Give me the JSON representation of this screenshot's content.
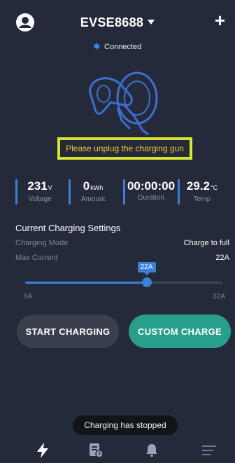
{
  "header": {
    "device_name": "EVSE8688",
    "avatar_icon": "user-avatar-icon",
    "dropdown_icon": "caret-down-icon",
    "add_icon": "plus-icon",
    "add_label": "+"
  },
  "connection": {
    "icon": "bluetooth-icon",
    "glyph": "✱",
    "status": "Connected"
  },
  "notice": {
    "text": "Please unplug the charging gun",
    "highlight_color": "#d8e632",
    "text_color": "#f1cc2e"
  },
  "stats": [
    {
      "value": "231",
      "unit": "V",
      "label": "Voltage"
    },
    {
      "value": "0",
      "unit": "kWh",
      "label": "Amount"
    },
    {
      "value": "00:00:00",
      "unit": "",
      "label": "Duration"
    },
    {
      "value": "29.2",
      "unit": "°C",
      "label": "Temp"
    }
  ],
  "settings": {
    "title": "Current Charging Settings",
    "mode_label": "Charging Mode",
    "mode_value": "Charge to full",
    "current_label": "Max Current",
    "current_value": "22A",
    "slider": {
      "min": 6,
      "max": 32,
      "value": 22,
      "min_label": "6A",
      "max_label": "32A",
      "tooltip": "22A"
    }
  },
  "buttons": {
    "start": "START CHARGING",
    "custom": "CUSTOM CHARGE"
  },
  "toast": "Charging has stopped",
  "nav": [
    {
      "icon": "lightning-icon",
      "active": true
    },
    {
      "icon": "records-icon",
      "active": false
    },
    {
      "icon": "bell-icon",
      "active": false
    },
    {
      "icon": "menu-icon",
      "active": false
    }
  ],
  "colors": {
    "background": "#252a3b",
    "accent_blue": "#3a80d8",
    "custom_button": "#289e8d",
    "start_button": "#3a3f4d"
  }
}
